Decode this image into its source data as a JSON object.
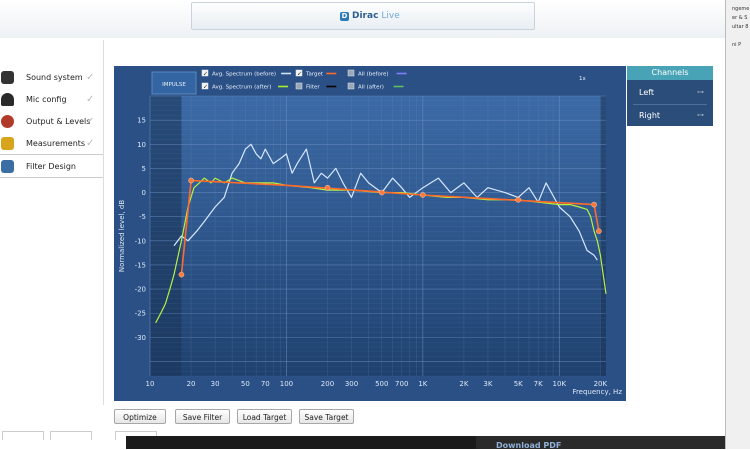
{
  "app": {
    "logo_part1": "Dirac",
    "logo_part2": "Live",
    "logo_mark": "D"
  },
  "sidebar": {
    "items": [
      {
        "label": "Sound system",
        "icon": "speaker-icon",
        "color": "#333333",
        "done": true
      },
      {
        "label": "Mic config",
        "icon": "microphone-icon",
        "color": "#2a2a2a",
        "done": true
      },
      {
        "label": "Output & Levels",
        "icon": "output-levels-icon",
        "color": "#b23a2a",
        "done": true
      },
      {
        "label": "Measurements",
        "icon": "measurements-icon",
        "color": "#d8a41c",
        "done": true
      },
      {
        "label": "Filter Design",
        "icon": "filter-design-icon",
        "color": "#3a6ea5",
        "done": false
      }
    ],
    "check_glyph": "✓"
  },
  "legend": {
    "impulse_button": "IMPULSE",
    "row1": [
      {
        "label": "Avg. Spectrum (before)",
        "checked": true,
        "color": "#cfe3ff"
      },
      {
        "label": "Target",
        "checked": true,
        "color": "#ff6a2a"
      },
      {
        "label": "All (before)",
        "checked": false,
        "color": "#8080ff"
      }
    ],
    "row2": [
      {
        "label": "Avg. Spectrum (after)",
        "checked": true,
        "color": "#a8f030"
      },
      {
        "label": "Filter",
        "checked": false,
        "color": "#000000"
      },
      {
        "label": "All (after)",
        "checked": false,
        "color": "#60c060"
      }
    ],
    "zoom": "1x"
  },
  "chart_data": {
    "type": "line",
    "ylabel": "Normalized level, dB",
    "xlabel": "Frequency, Hz",
    "xscale": "log",
    "xlim": [
      10,
      22000
    ],
    "ylim": [
      -38,
      20
    ],
    "yticks": [
      15,
      10,
      5,
      0,
      -5,
      -10,
      -15,
      -20,
      -25,
      -30
    ],
    "xticks": [
      {
        "v": 10,
        "t": "10"
      },
      {
        "v": 20,
        "t": "20"
      },
      {
        "v": 30,
        "t": "30"
      },
      {
        "v": 50,
        "t": "50"
      },
      {
        "v": 70,
        "t": "70"
      },
      {
        "v": 100,
        "t": "100"
      },
      {
        "v": 200,
        "t": "200"
      },
      {
        "v": 300,
        "t": "300"
      },
      {
        "v": 500,
        "t": "500"
      },
      {
        "v": 700,
        "t": "700"
      },
      {
        "v": 1000,
        "t": "1K"
      },
      {
        "v": 2000,
        "t": "2K"
      },
      {
        "v": 3000,
        "t": "3K"
      },
      {
        "v": 5000,
        "t": "5K"
      },
      {
        "v": 7000,
        "t": "7K"
      },
      {
        "v": 10000,
        "t": "10K"
      },
      {
        "v": 20000,
        "t": "20K"
      }
    ],
    "excluded_regions": [
      [
        10,
        17
      ],
      [
        20000,
        22000
      ]
    ],
    "grid": true,
    "series": [
      {
        "name": "Avg. Spectrum (before)",
        "color": "#d6e8ff",
        "x": [
          15,
          17,
          19,
          22,
          25,
          30,
          35,
          40,
          45,
          50,
          55,
          60,
          65,
          70,
          80,
          90,
          100,
          110,
          120,
          140,
          160,
          180,
          200,
          230,
          260,
          300,
          350,
          400,
          500,
          600,
          700,
          800,
          1000,
          1300,
          1600,
          2000,
          2500,
          3000,
          4000,
          5000,
          6000,
          7000,
          8000,
          10000,
          12000,
          14000,
          16000,
          18000,
          19000
        ],
        "y": [
          -11,
          -9,
          -10,
          -8,
          -6,
          -3,
          -1,
          4,
          6,
          9,
          10,
          8,
          7,
          9,
          6,
          7,
          8,
          4,
          6,
          9,
          2,
          4,
          3,
          5,
          2,
          -1,
          4,
          2,
          0,
          3,
          1,
          -1,
          1,
          3,
          0,
          2,
          -1,
          1,
          0,
          -1,
          1,
          -2,
          2,
          -3,
          -5,
          -8,
          -12,
          -13,
          -14
        ]
      },
      {
        "name": "Avg. Spectrum (after)",
        "color": "#b6f043",
        "x": [
          11,
          12,
          13,
          14,
          15,
          17,
          19,
          21,
          23,
          25,
          28,
          30,
          35,
          40,
          50,
          60,
          80,
          100,
          150,
          200,
          300,
          500,
          700,
          1000,
          1500,
          2000,
          3000,
          5000,
          7000,
          10000,
          12000,
          14000,
          16000,
          17000,
          18000,
          19000,
          20000,
          21000,
          22000
        ],
        "y": [
          -27,
          -25,
          -23,
          -20,
          -17,
          -10,
          -3,
          1,
          2,
          3,
          2,
          3,
          2,
          3,
          2,
          2,
          2,
          1.5,
          1,
          0.5,
          0.5,
          0,
          0,
          -0.5,
          -1,
          -1,
          -1.5,
          -1.5,
          -2,
          -2.5,
          -2.5,
          -3,
          -3.5,
          -5,
          -8,
          -10,
          -13,
          -17,
          -21
        ]
      },
      {
        "name": "Target",
        "color": "#ff6a2a",
        "x": [
          17,
          20,
          100,
          1000,
          18000,
          19500
        ],
        "y": [
          -17,
          2.5,
          1.5,
          -0.5,
          -2.5,
          -8
        ]
      }
    ],
    "target_points": [
      {
        "x": 17,
        "y": -17
      },
      {
        "x": 20,
        "y": 2.5
      },
      {
        "x": 200,
        "y": 1
      },
      {
        "x": 500,
        "y": 0
      },
      {
        "x": 1000,
        "y": -0.5
      },
      {
        "x": 5000,
        "y": -1.5
      },
      {
        "x": 18000,
        "y": -2.5
      },
      {
        "x": 19500,
        "y": -8
      }
    ]
  },
  "channels": {
    "title": "Channels",
    "items": [
      {
        "label": "Left",
        "key": "⊶"
      },
      {
        "label": "Right",
        "key": "⊶"
      }
    ]
  },
  "buttons": {
    "optimize": "Optimize",
    "save_filter": "Save Filter",
    "load_target": "Load Target",
    "save_target": "Save Target"
  },
  "bottom": {
    "download": "Download PDF"
  },
  "right_strip": {
    "lines": [
      "ngeme",
      "er & S",
      "ultar 8",
      "ni P"
    ]
  }
}
